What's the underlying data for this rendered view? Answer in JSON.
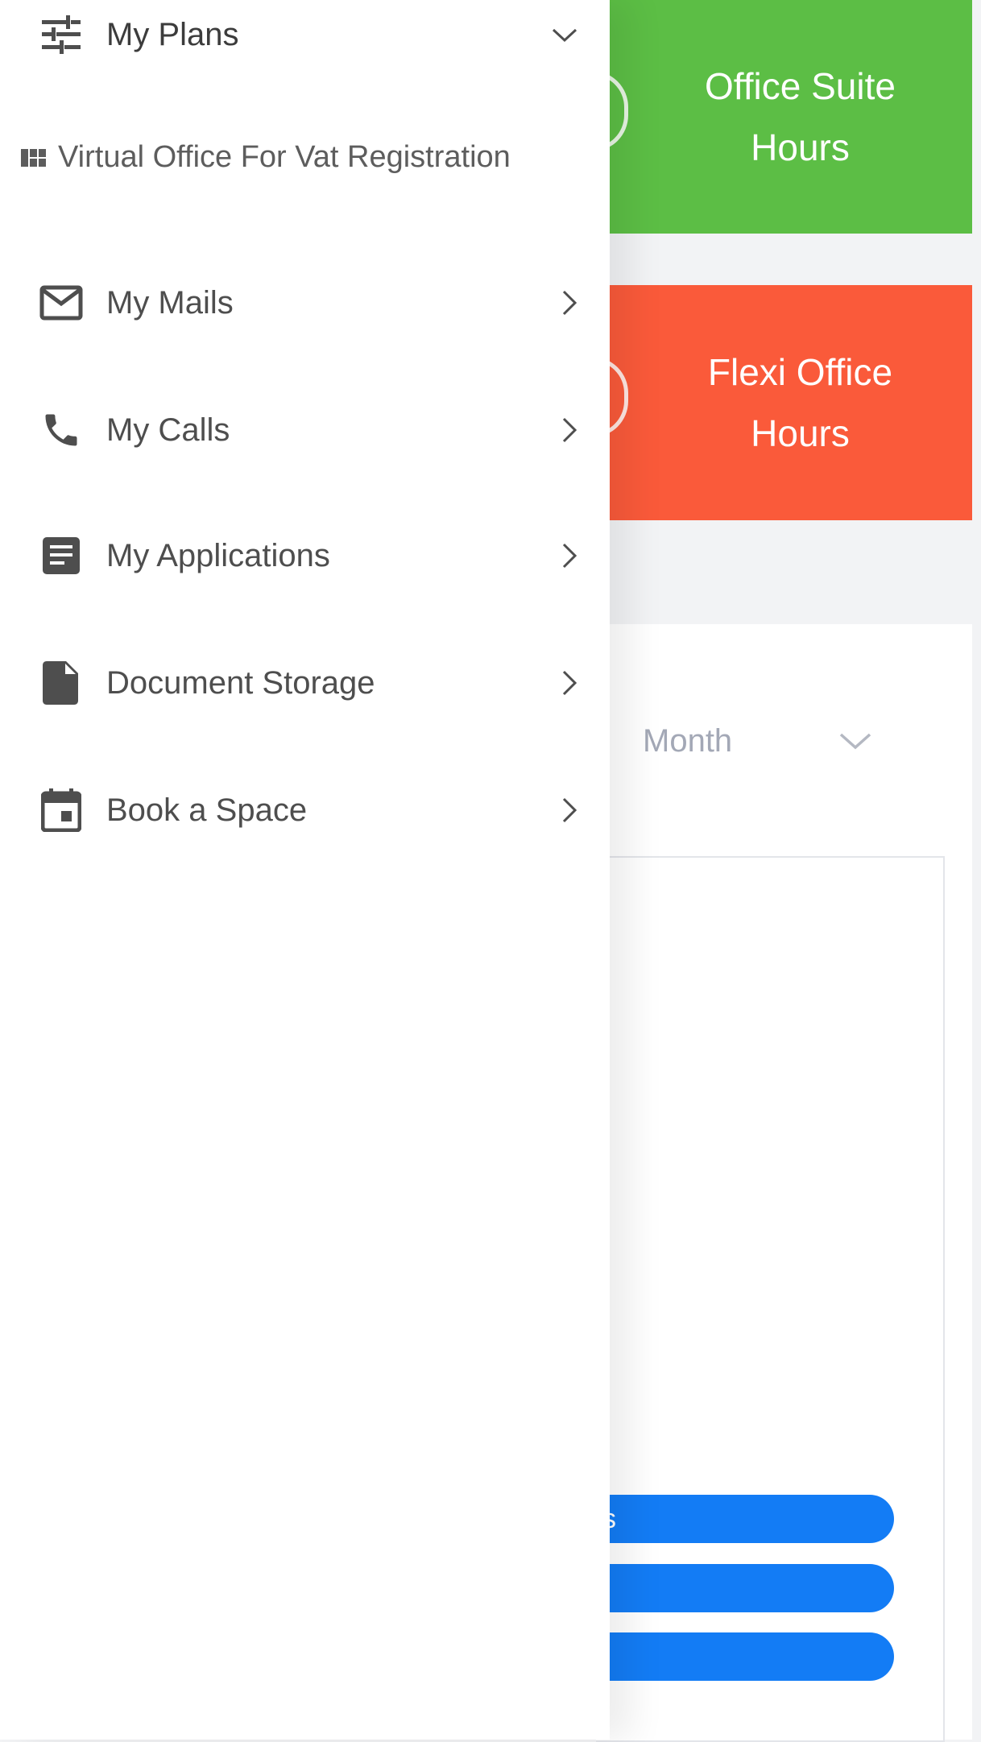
{
  "background": {
    "cards": [
      {
        "label": "Office Suite Hours",
        "color": "#5cbe45"
      },
      {
        "label": "Flexi Office Hours",
        "color": "#fa5a3a"
      }
    ],
    "period_select": {
      "value": "Month"
    },
    "buttons": [
      {
        "label": "s"
      },
      {
        "label": ""
      },
      {
        "label": ""
      }
    ],
    "accent": "#137cf5"
  },
  "drawer": {
    "plans": {
      "label": "My Plans",
      "icon": "tune-icon"
    },
    "plan_subitem": {
      "label": "Virtual Office For Vat Registration",
      "icon": "plan-icon"
    },
    "items": [
      {
        "label": "My Mails",
        "icon": "mail-icon"
      },
      {
        "label": "My Calls",
        "icon": "phone-icon"
      },
      {
        "label": "My Applications",
        "icon": "applications-icon"
      },
      {
        "label": "Document Storage",
        "icon": "document-icon"
      },
      {
        "label": "Book a Space",
        "icon": "calendar-icon"
      }
    ]
  }
}
